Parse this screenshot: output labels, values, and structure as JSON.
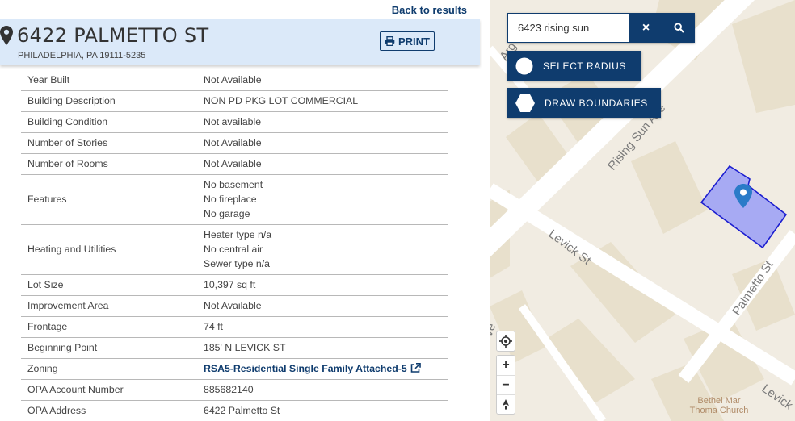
{
  "header": {
    "back_link": "Back to results",
    "street": "6422 PALMETTO ST",
    "city": "PHILADELPHIA, PA 19111-5235",
    "print_label": "PRINT"
  },
  "details": [
    {
      "label": "Year Built",
      "lines": [
        "Not Available"
      ]
    },
    {
      "label": "Building Description",
      "lines": [
        "NON PD PKG LOT COMMERCIAL"
      ]
    },
    {
      "label": "Building Condition",
      "lines": [
        "Not available"
      ]
    },
    {
      "label": "Number of Stories",
      "lines": [
        "Not Available"
      ]
    },
    {
      "label": "Number of Rooms",
      "lines": [
        "Not Available"
      ]
    },
    {
      "label": "Features",
      "lines": [
        "No basement",
        "No fireplace",
        "No garage"
      ]
    },
    {
      "label": "Heating and Utilities",
      "lines": [
        "Heater type n/a",
        "No central air",
        "Sewer type n/a"
      ]
    },
    {
      "label": "Lot Size",
      "lines": [
        "10,397 sq ft"
      ]
    },
    {
      "label": "Improvement Area",
      "lines": [
        "Not Available"
      ]
    },
    {
      "label": "Frontage",
      "lines": [
        "74 ft"
      ]
    },
    {
      "label": "Beginning Point",
      "lines": [
        "185' N LEVICK ST"
      ]
    },
    {
      "label": "Zoning",
      "lines": [
        "RSA5-Residential Single Family Attached-5"
      ],
      "link": true
    },
    {
      "label": "OPA Account Number",
      "lines": [
        "885682140"
      ]
    },
    {
      "label": "OPA Address",
      "lines": [
        "6422 Palmetto St"
      ]
    }
  ],
  "map": {
    "search_value": "6423 rising sun",
    "select_radius_label": "SELECT RADIUS",
    "draw_boundaries_label": "DRAW BOUNDARIES",
    "zoom_in": "+",
    "zoom_out": "−",
    "street_labels": {
      "rising_sun": "Rising Sun Ave",
      "levick": "Levick St",
      "palmetto": "Palmetto St",
      "levick_edge": "Levick",
      "argus": "Arg",
      "edge_fragment": "ve"
    },
    "poi_line1": "Bethel Mar",
    "poi_line2": "Thoma Church"
  },
  "colors": {
    "brand": "#0f3c6e",
    "card_bg": "#dbe9f9",
    "parcel_fill": "#9ea3f5",
    "parcel_stroke": "#1c1ed0",
    "pin": "#2b7bc8",
    "block": "#e8e0cc",
    "map_bg": "#f1ece2",
    "road": "#ffffff"
  },
  "icons": [
    "map-marker-icon",
    "print-icon",
    "external-link-icon",
    "close-icon",
    "search-icon",
    "circle-icon",
    "hexagon-icon",
    "locate-icon",
    "compass-icon"
  ]
}
